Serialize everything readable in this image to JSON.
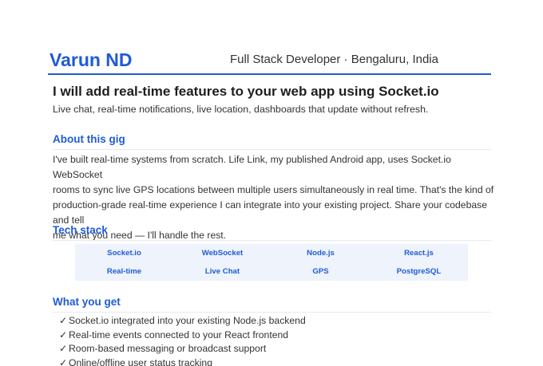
{
  "header": {
    "name": "Varun ND",
    "tagline": "Full Stack Developer · Bengaluru, India"
  },
  "gig": {
    "title": "I will add real-time features to your web app using Socket.io",
    "subtitle": "Live chat, real-time notifications, live location, dashboards that update without refresh."
  },
  "about": {
    "heading": "About this gig",
    "lines": [
      "I've built real-time systems from scratch. Life Link, my published Android app, uses Socket.io WebSocket",
      "rooms to sync live GPS locations between multiple users simultaneously in real time. That's the kind of",
      "production-grade real-time experience I can integrate into your existing project. Share your codebase and tell",
      "me what you need — I'll handle the rest."
    ]
  },
  "tech": {
    "heading": "Tech stack",
    "items": [
      "Socket.io",
      "WebSocket",
      "Node.js",
      "React.js",
      "Real-time",
      "Live Chat",
      "GPS",
      "PostgreSQL"
    ]
  },
  "deliverables": {
    "heading": "What you get",
    "check_glyph": "✓",
    "items": [
      "Socket.io integrated into your existing Node.js backend",
      "Real-time events connected to your React frontend",
      "Room-based messaging or broadcast support",
      "Online/offline user status tracking"
    ]
  },
  "colors": {
    "accent": "#1f5bd6",
    "tech_bg": "#eef3fc"
  }
}
